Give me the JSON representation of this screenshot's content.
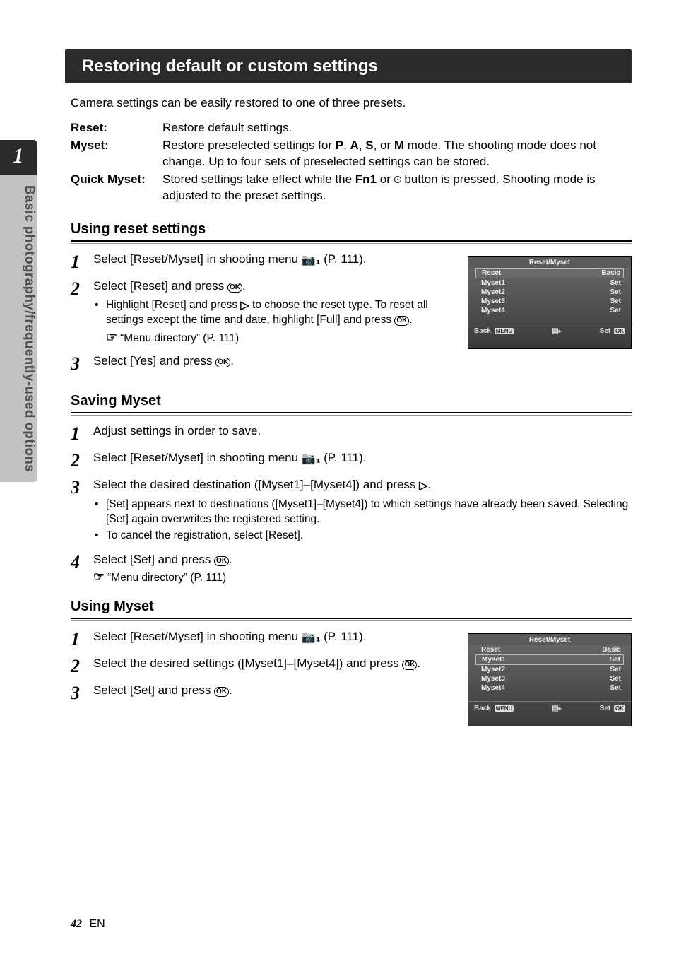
{
  "chapter_number": "1",
  "side_tab_label": "Basic photography/frequently-used options",
  "heading": "Restoring default or custom settings",
  "intro": "Camera settings can be easily restored to one of three presets.",
  "defs": {
    "reset_term": "Reset:",
    "reset_desc": "Restore default settings.",
    "myset_term": "Myset:",
    "myset_desc_pre": "Restore preselected settings for ",
    "myset_modes": {
      "p": "P",
      "a": "A",
      "s": "S",
      "m": "M"
    },
    "myset_desc_post": " mode. The shooting mode does not change. Up to four sets of preselected settings can be stored.",
    "quick_term": "Quick Myset:",
    "quick_desc_pre": "Stored settings take effect while the ",
    "quick_fn1": "Fn1",
    "quick_desc_mid": " or ",
    "quick_desc_post": " button is pressed. Shooting mode is adjusted to the preset settings."
  },
  "section1": {
    "title": "Using reset settings",
    "step1_pre": "Select [Reset/Myset] in shooting menu ",
    "step1_post": " (P. 111).",
    "step2_pre": "Select [Reset] and press ",
    "step2_post": ".",
    "bullet1_pre": "Highlight [Reset] and press ",
    "bullet1_mid": " to choose the reset type. To reset all settings except the time and date, highlight [Full] and press ",
    "bullet1_post": ".",
    "hint_text": "“Menu directory” (P. 111)",
    "step3_pre": "Select [Yes] and press ",
    "step3_post": "."
  },
  "section2": {
    "title": "Saving Myset",
    "step1": "Adjust settings in order to save.",
    "step2_pre": "Select [Reset/Myset] in shooting menu ",
    "step2_post": " (P. 111).",
    "step3_pre": "Select the desired destination ([Myset1]–[Myset4]) and press ",
    "step3_post": ".",
    "bullet1": "[Set] appears next to destinations ([Myset1]–[Myset4]) to which settings have already been saved. Selecting [Set] again overwrites the registered setting.",
    "bullet2": "To cancel the registration, select [Reset].",
    "step4_pre": "Select [Set] and press ",
    "step4_post": ".",
    "hint_text": "“Menu directory” (P. 111)"
  },
  "section3": {
    "title": "Using Myset",
    "step1_pre": "Select [Reset/Myset] in shooting menu ",
    "step1_post": " (P. 111).",
    "step2_pre": "Select the desired settings ([Myset1]–[Myset4]) and press ",
    "step2_post": ".",
    "step3_pre": "Select [Set] and press ",
    "step3_post": "."
  },
  "menu": {
    "title": "Reset/Myset",
    "rows": [
      {
        "label": "Reset",
        "value": "Basic"
      },
      {
        "label": "Myset1",
        "value": "Set"
      },
      {
        "label": "Myset2",
        "value": "Set"
      },
      {
        "label": "Myset3",
        "value": "Set"
      },
      {
        "label": "Myset4",
        "value": "Set"
      }
    ],
    "back_label": "Back",
    "back_badge": "MENU",
    "set_label": "Set",
    "ok_badge": "OK"
  },
  "footer": {
    "page": "42",
    "lang": "EN"
  },
  "glyph": {
    "ok": "OK",
    "tri_right": "▷",
    "tri_small": "▸",
    "ptr": "☞",
    "cam": "📷₁",
    "card": "▤"
  }
}
